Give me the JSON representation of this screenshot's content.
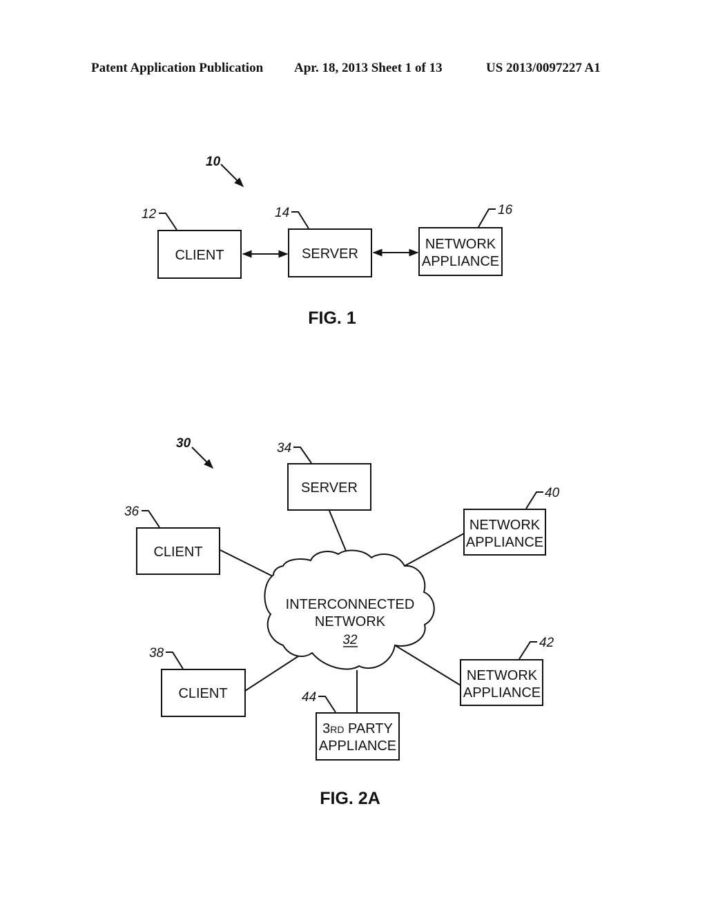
{
  "header": {
    "publication": "Patent Application Publication",
    "date_sheet": "Apr. 18, 2013  Sheet 1 of 13",
    "number": "US 2013/0097227 A1"
  },
  "fig1": {
    "ref": "10",
    "caption": "FIG. 1",
    "nodes": [
      {
        "ref": "12",
        "lines": [
          "CLIENT"
        ]
      },
      {
        "ref": "14",
        "lines": [
          "SERVER"
        ]
      },
      {
        "ref": "16",
        "lines": [
          "NETWORK",
          "APPLIANCE"
        ]
      }
    ],
    "connections": [
      {
        "from": "12",
        "to": "14",
        "type": "bidirectional"
      },
      {
        "from": "14",
        "to": "16",
        "type": "bidirectional"
      }
    ]
  },
  "fig2a": {
    "ref": "30",
    "caption": "FIG. 2A",
    "network": {
      "ref": "32",
      "lines": [
        "INTERCONNECTED",
        "NETWORK"
      ]
    },
    "nodes": [
      {
        "ref": "34",
        "lines": [
          "SERVER"
        ]
      },
      {
        "ref": "36",
        "lines": [
          "CLIENT"
        ]
      },
      {
        "ref": "38",
        "lines": [
          "CLIENT"
        ]
      },
      {
        "ref": "40",
        "lines": [
          "NETWORK",
          "APPLIANCE"
        ]
      },
      {
        "ref": "42",
        "lines": [
          "NETWORK",
          "APPLIANCE"
        ]
      },
      {
        "ref": "44",
        "lines_prefix": "3",
        "lines_sup": "RD",
        "lines": [
          "PARTY",
          "APPLIANCE"
        ]
      }
    ],
    "connections": [
      {
        "from": "32",
        "to": "34"
      },
      {
        "from": "32",
        "to": "36"
      },
      {
        "from": "32",
        "to": "38"
      },
      {
        "from": "32",
        "to": "40"
      },
      {
        "from": "32",
        "to": "42"
      },
      {
        "from": "32",
        "to": "44"
      }
    ]
  }
}
